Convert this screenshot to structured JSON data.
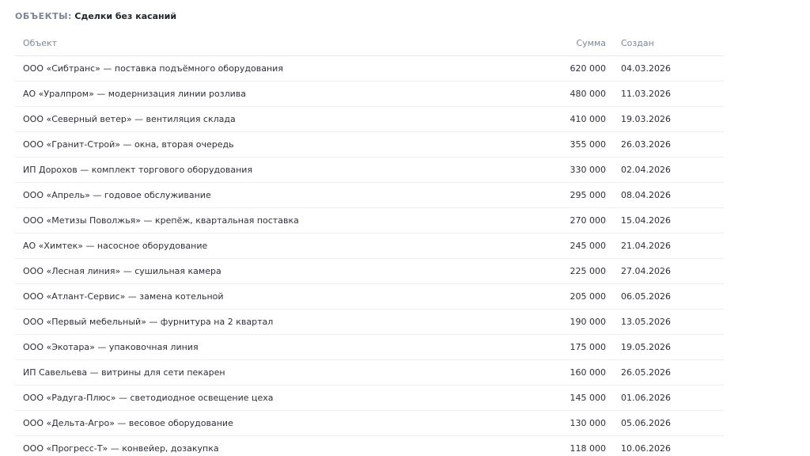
{
  "header": {
    "prefix": "ОБЪЕКТЫ",
    "separator": ":",
    "value": "Сделки без касаний"
  },
  "table": {
    "columns": {
      "object": "Объект",
      "sum": "Сумма",
      "created": "Создан"
    },
    "rows": [
      {
        "object": "ООО «Сибтранс» — поставка подъёмного оборудования",
        "sum": "620 000",
        "created": "04.03.2026"
      },
      {
        "object": "АО «Уралпром» — модернизация линии розлива",
        "sum": "480 000",
        "created": "11.03.2026"
      },
      {
        "object": "ООО «Северный ветер» — вентиляция склада",
        "sum": "410 000",
        "created": "19.03.2026"
      },
      {
        "object": "ООО «Гранит-Строй» — окна, вторая очередь",
        "sum": "355 000",
        "created": "26.03.2026"
      },
      {
        "object": "ИП Дорохов — комплект торгового оборудования",
        "sum": "330 000",
        "created": "02.04.2026"
      },
      {
        "object": "ООО «Апрель» — годовое обслуживание",
        "sum": "295 000",
        "created": "08.04.2026"
      },
      {
        "object": "ООО «Метизы Поволжья» — крепёж, квартальная поставка",
        "sum": "270 000",
        "created": "15.04.2026"
      },
      {
        "object": "АО «Химтек» — насосное оборудование",
        "sum": "245 000",
        "created": "21.04.2026"
      },
      {
        "object": "ООО «Лесная линия» — сушильная камера",
        "sum": "225 000",
        "created": "27.04.2026"
      },
      {
        "object": "ООО «Атлант-Сервис» — замена котельной",
        "sum": "205 000",
        "created": "06.05.2026"
      },
      {
        "object": "ООО «Первый мебельный» — фурнитура на 2 квартал",
        "sum": "190 000",
        "created": "13.05.2026"
      },
      {
        "object": "ООО «Экотара» — упаковочная линия",
        "sum": "175 000",
        "created": "19.05.2026"
      },
      {
        "object": "ИП Савельева — витрины для сети пекарен",
        "sum": "160 000",
        "created": "26.05.2026"
      },
      {
        "object": "ООО «Радуга-Плюс» — светодиодное освещение цеха",
        "sum": "145 000",
        "created": "01.06.2026"
      },
      {
        "object": "ООО «Дельта-Агро» — весовое оборудование",
        "sum": "130 000",
        "created": "05.06.2026"
      },
      {
        "object": "ООО «Прогресс-Т» — конвейер, дозакупка",
        "sum": "118 000",
        "created": "10.06.2026"
      }
    ]
  }
}
